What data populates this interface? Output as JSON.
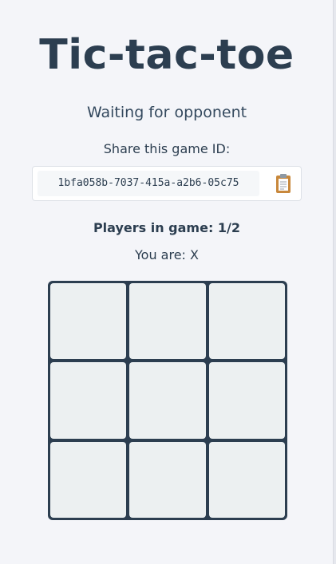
{
  "page": {
    "title": "Tic-tac-toe",
    "status": "Waiting for opponent",
    "share_label": "Share this game ID:",
    "game_id": "1bfa058b-7037-415a-a2b6-05c75",
    "copy_icon": "clipboard-icon",
    "players_text": "Players in game: 1/2",
    "you_are_text": "You are: X"
  },
  "board": {
    "cells": [
      "",
      "",
      "",
      "",
      "",
      "",
      "",
      "",
      ""
    ]
  },
  "colors": {
    "text": "#2c3e50",
    "background": "#f4f5f9",
    "cell": "#ecf0f1",
    "grid": "#2c3e50",
    "clipboard": "#c8883c"
  }
}
